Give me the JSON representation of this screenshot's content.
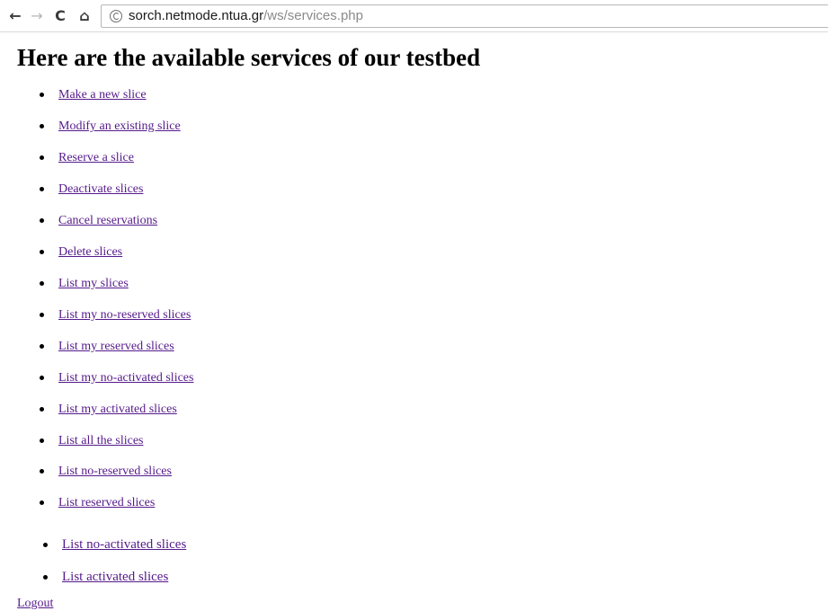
{
  "browser": {
    "back_glyph": "←",
    "forward_glyph": "→",
    "reload_glyph": "C",
    "home_glyph": "⌂",
    "url_host": "sorch.netmode.ntua.gr",
    "url_path": "/ws/services.php"
  },
  "page": {
    "heading": "Here are the available services of our testbed",
    "link_color": "#551a8b",
    "services": [
      {
        "label": "Make a new slice"
      },
      {
        "label": "Modify an existing slice"
      },
      {
        "label": "Reserve a slice"
      },
      {
        "label": "Deactivate slices"
      },
      {
        "label": "Cancel reservations"
      },
      {
        "label": "Delete slices"
      },
      {
        "label": "List my slices"
      },
      {
        "label": "List my no-reserved slices"
      },
      {
        "label": "List my reserved slices"
      },
      {
        "label": "List my no-activated slices"
      },
      {
        "label": "List my activated slices"
      },
      {
        "label": "List all the slices"
      },
      {
        "label": "List no-reserved slices"
      },
      {
        "label": "List reserved slices"
      },
      {
        "label": "List no-activated slices"
      },
      {
        "label": "List activated slices"
      }
    ],
    "logout_label": "Logout"
  }
}
